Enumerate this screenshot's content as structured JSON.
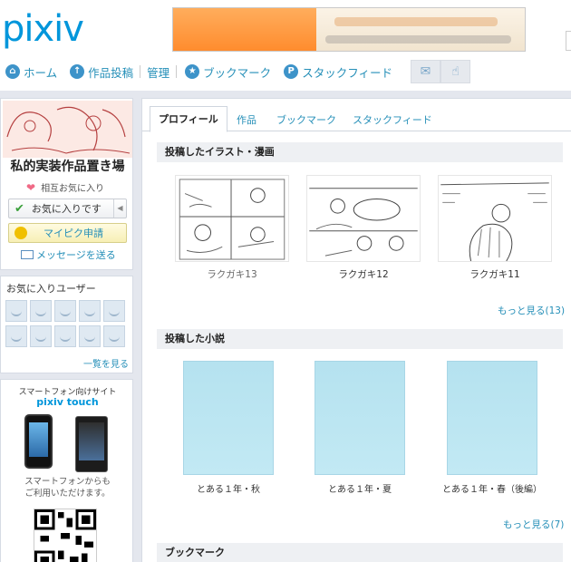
{
  "header": {
    "logo": "pixiv"
  },
  "nav": {
    "home": "ホーム",
    "post": "作品投稿",
    "manage": "管理",
    "bookmark": "ブックマーク",
    "stackfeed": "スタックフィード"
  },
  "profile": {
    "name": "私的実装作品置き場",
    "mutual": "相互お気に入り",
    "fav_button": "お気に入りです",
    "mypixiv_button": "マイピク申請",
    "message": "メッセージを送る"
  },
  "fav_users": {
    "title": "お気に入りユーザー",
    "more": "一覧を見る"
  },
  "smartphone": {
    "line1": "スマートフォン向けサイト",
    "line2": "pixiv touch",
    "line3": "スマートフォンからも",
    "line4": "ご利用いただけます。"
  },
  "tabs": [
    "プロフィール",
    "作品",
    "ブックマーク",
    "スタックフィード"
  ],
  "illust": {
    "heading": "投稿したイラスト・漫画",
    "items": [
      "ラクガキ13",
      "ラクガキ12",
      "ラクガキ11"
    ],
    "more": "もっと見る(13)"
  },
  "novel": {
    "heading": "投稿した小説",
    "items": [
      "とある１年・秋",
      "とある１年・夏",
      "とある１年・春（後編）"
    ],
    "more": "もっと見る(7)"
  },
  "bookmark_section": {
    "heading": "ブックマーク"
  },
  "colors": {
    "accent": "#0096db",
    "link": "#258fb8",
    "novel_cover": "#b8e3f0"
  }
}
